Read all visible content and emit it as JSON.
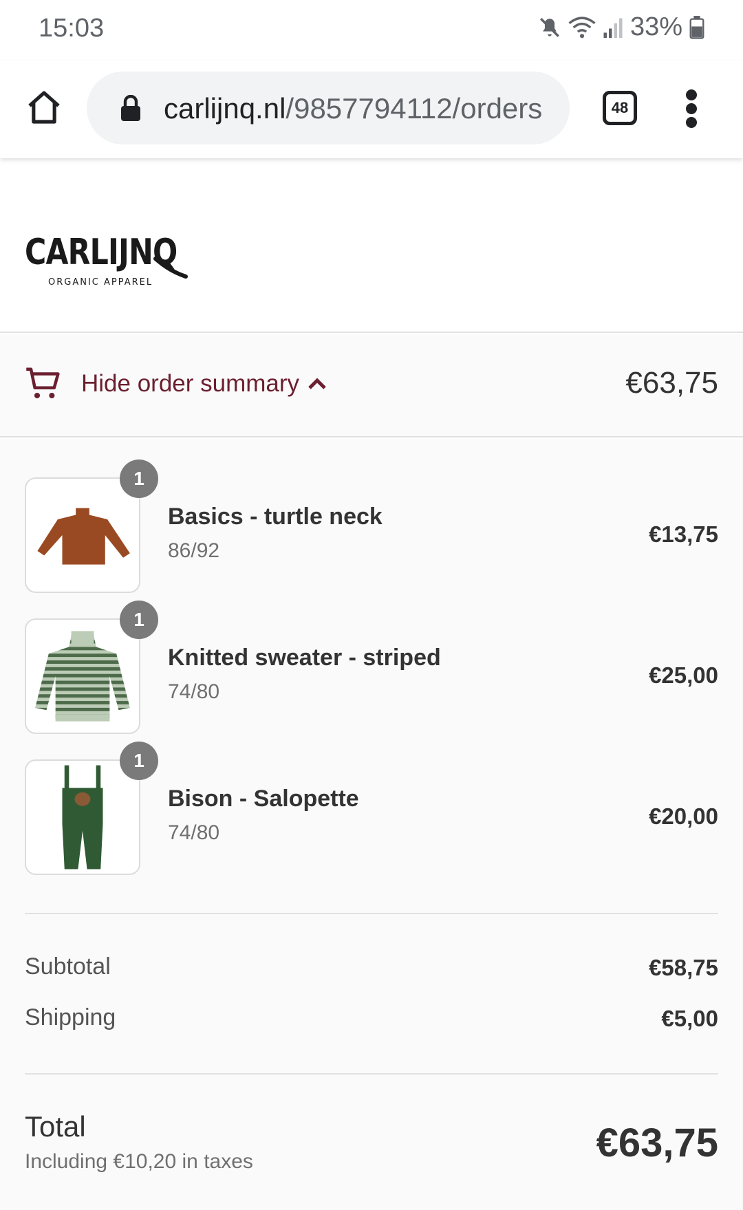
{
  "status_bar": {
    "time": "15:03",
    "battery": "33%"
  },
  "browser": {
    "url_domain": "carlijnq.nl",
    "url_path": "/9857794112/orders",
    "tab_count": "48"
  },
  "store": {
    "logo_text": "CARLIJNQ",
    "logo_tagline": "ORGANIC APPAREL"
  },
  "summary_toggle": {
    "label": "Hide order summary",
    "total": "€63,75"
  },
  "products": [
    {
      "quantity": "1",
      "name": "Basics - turtle neck",
      "variant": "86/92",
      "price": "€13,75",
      "color": "#9a4a22"
    },
    {
      "quantity": "1",
      "name": "Knitted sweater - striped",
      "variant": "74/80",
      "price": "€25,00",
      "color": "#6f8a6a"
    },
    {
      "quantity": "1",
      "name": "Bison - Salopette",
      "variant": "74/80",
      "price": "€20,00",
      "color": "#2f5a34"
    }
  ],
  "totals": {
    "subtotal_label": "Subtotal",
    "subtotal_value": "€58,75",
    "shipping_label": "Shipping",
    "shipping_value": "€5,00",
    "total_label": "Total",
    "tax_note": "Including €10,20 in taxes",
    "total_value": "€63,75"
  },
  "colors": {
    "accent": "#6b1f2f",
    "background": "#fafafa",
    "badge": "#7a7a7a"
  }
}
